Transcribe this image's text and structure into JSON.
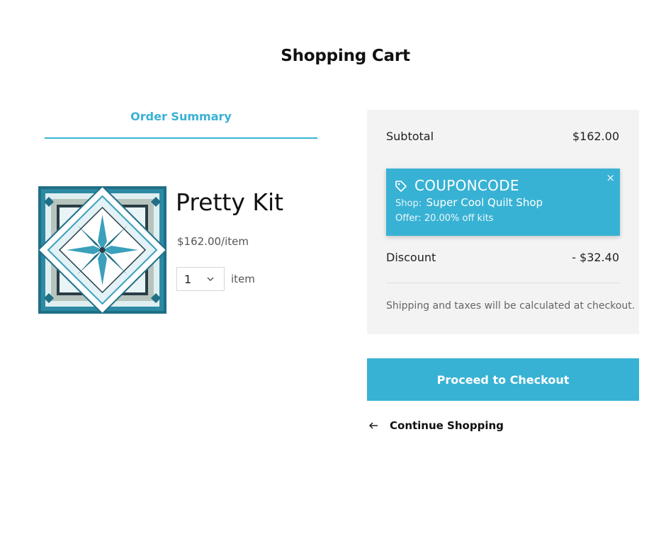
{
  "page": {
    "title": "Shopping Cart"
  },
  "summary": {
    "tab_label": "Order Summary"
  },
  "product": {
    "title": "Pretty Kit",
    "price": "$162.00/item",
    "quantity": "1",
    "quantity_unit": "item",
    "image_icon": "quilt-star-pattern"
  },
  "totals": {
    "subtotal_label": "Subtotal",
    "subtotal_value": "$162.00",
    "discount_label": "Discount",
    "discount_value": "- $32.40",
    "shipping_note": "Shipping and taxes will be calculated at checkout."
  },
  "coupon": {
    "code": "COUPONCODE",
    "shop_label": "Shop:",
    "shop_name": "Super Cool Quilt Shop",
    "offer": "Offer: 20.00% off kits",
    "close": "×",
    "icon": "tag-icon"
  },
  "actions": {
    "checkout_label": "Proceed to Checkout",
    "continue_label": "Continue Shopping"
  },
  "colors": {
    "accent": "#38b2d4",
    "panel_bg": "#f3f3f3",
    "quilt_dark": "#1f6f86",
    "quilt_light": "#dff1f5"
  }
}
